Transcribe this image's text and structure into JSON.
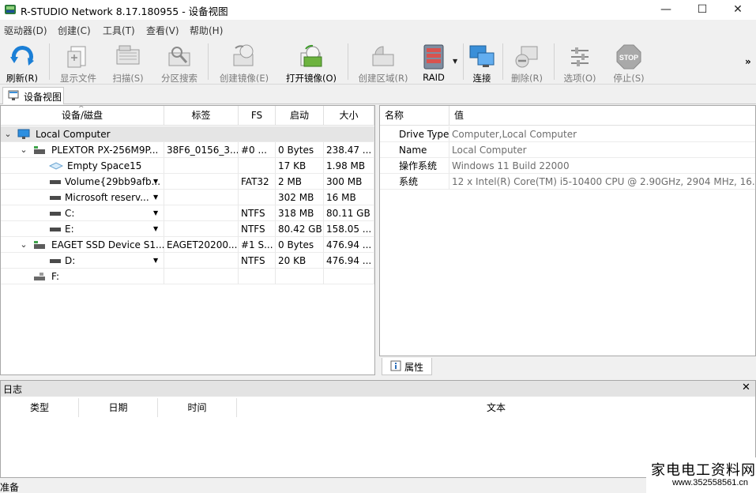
{
  "window": {
    "title": "R-STUDIO Network 8.17.180955 - 设备视图",
    "minimize": "—",
    "maximize": "☐",
    "close": "✕"
  },
  "menu": [
    "驱动器(D)",
    "创建(C)",
    "工具(T)",
    "查看(V)",
    "帮助(H)"
  ],
  "toolbar": {
    "refresh": "刷新(R)",
    "show_files": "显示文件",
    "scan": "扫描(S)",
    "partition_search": "分区搜索",
    "create_image": "创建镜像(E)",
    "open_image": "打开镜像(O)",
    "create_region": "创建区域(R)",
    "raid": "RAID",
    "connect": "连接",
    "delete": "删除(R)",
    "options": "选项(O)",
    "stop": "停止(S)",
    "stop_badge": "STOP",
    "more": "»"
  },
  "tab": {
    "device_view": "设备视图"
  },
  "tree": {
    "columns": [
      "设备/磁盘",
      "标签",
      "FS",
      "启动",
      "大小"
    ],
    "rows": [
      {
        "name": "Local Computer",
        "label": "",
        "fs": "",
        "start": "",
        "size": ""
      },
      {
        "name": "PLEXTOR PX-256M9P...",
        "label": "38F6_0156_3...",
        "fs": "#0 ...",
        "start": "0 Bytes",
        "size": "238.47 ..."
      },
      {
        "name": "Empty Space15",
        "label": "",
        "fs": "",
        "start": "17 KB",
        "size": "1.98 MB"
      },
      {
        "name": "Volume{29bb9afb...",
        "label": "",
        "fs": "FAT32",
        "start": "2 MB",
        "size": "300 MB"
      },
      {
        "name": "Microsoft reserv...",
        "label": "",
        "fs": "",
        "start": "302 MB",
        "size": "16 MB"
      },
      {
        "name": "C:",
        "label": "",
        "fs": "NTFS",
        "start": "318 MB",
        "size": "80.11 GB"
      },
      {
        "name": "E:",
        "label": "",
        "fs": "NTFS",
        "start": "80.42 GB",
        "size": "158.05 ..."
      },
      {
        "name": "EAGET SSD Device S1...",
        "label": "EAGET20200...",
        "fs": "#1 S...",
        "start": "0 Bytes",
        "size": "476.94 ..."
      },
      {
        "name": "D:",
        "label": "",
        "fs": "NTFS",
        "start": "20 KB",
        "size": "476.94 ..."
      },
      {
        "name": "F:",
        "label": "",
        "fs": "",
        "start": "",
        "size": ""
      }
    ]
  },
  "properties": {
    "columns": [
      "名称",
      "值"
    ],
    "rows": [
      {
        "name": "Drive Type",
        "value": "Computer,Local Computer"
      },
      {
        "name": "Name",
        "value": "Local Computer"
      },
      {
        "name": "操作系统",
        "value": "Windows 11 Build 22000"
      },
      {
        "name": "系统",
        "value": "12 x Intel(R) Core(TM) i5-10400 CPU @ 2.90GHz, 2904 MHz, 16..."
      }
    ],
    "tab": "属性"
  },
  "log": {
    "title": "日志",
    "close": "✕",
    "columns": [
      "类型",
      "日期",
      "时间",
      "文本"
    ]
  },
  "status": {
    "text": "准备"
  },
  "watermark": {
    "line1": "家电电工资料网",
    "line2": "www.352558561.cn"
  }
}
